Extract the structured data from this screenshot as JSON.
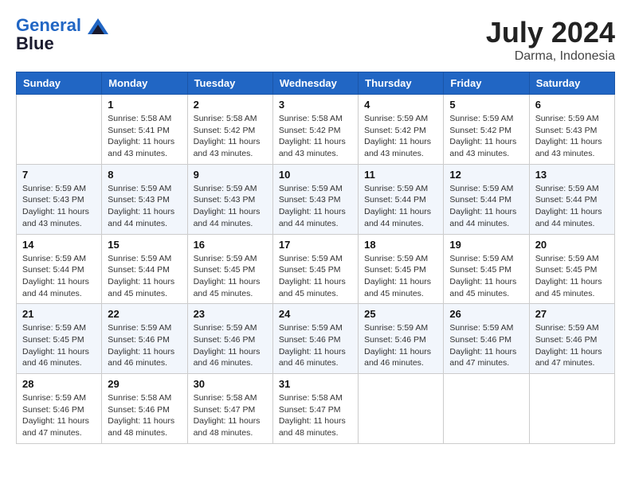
{
  "header": {
    "logo_line1": "General",
    "logo_line2": "Blue",
    "month_year": "July 2024",
    "location": "Darma, Indonesia"
  },
  "weekdays": [
    "Sunday",
    "Monday",
    "Tuesday",
    "Wednesday",
    "Thursday",
    "Friday",
    "Saturday"
  ],
  "weeks": [
    [
      {
        "day": "",
        "empty": true
      },
      {
        "day": "1",
        "sunrise": "5:58 AM",
        "sunset": "5:41 PM",
        "daylight": "11 hours and 43 minutes."
      },
      {
        "day": "2",
        "sunrise": "5:58 AM",
        "sunset": "5:42 PM",
        "daylight": "11 hours and 43 minutes."
      },
      {
        "day": "3",
        "sunrise": "5:58 AM",
        "sunset": "5:42 PM",
        "daylight": "11 hours and 43 minutes."
      },
      {
        "day": "4",
        "sunrise": "5:59 AM",
        "sunset": "5:42 PM",
        "daylight": "11 hours and 43 minutes."
      },
      {
        "day": "5",
        "sunrise": "5:59 AM",
        "sunset": "5:42 PM",
        "daylight": "11 hours and 43 minutes."
      },
      {
        "day": "6",
        "sunrise": "5:59 AM",
        "sunset": "5:43 PM",
        "daylight": "11 hours and 43 minutes."
      }
    ],
    [
      {
        "day": "7",
        "sunrise": "5:59 AM",
        "sunset": "5:43 PM",
        "daylight": "11 hours and 43 minutes."
      },
      {
        "day": "8",
        "sunrise": "5:59 AM",
        "sunset": "5:43 PM",
        "daylight": "11 hours and 44 minutes."
      },
      {
        "day": "9",
        "sunrise": "5:59 AM",
        "sunset": "5:43 PM",
        "daylight": "11 hours and 44 minutes."
      },
      {
        "day": "10",
        "sunrise": "5:59 AM",
        "sunset": "5:43 PM",
        "daylight": "11 hours and 44 minutes."
      },
      {
        "day": "11",
        "sunrise": "5:59 AM",
        "sunset": "5:44 PM",
        "daylight": "11 hours and 44 minutes."
      },
      {
        "day": "12",
        "sunrise": "5:59 AM",
        "sunset": "5:44 PM",
        "daylight": "11 hours and 44 minutes."
      },
      {
        "day": "13",
        "sunrise": "5:59 AM",
        "sunset": "5:44 PM",
        "daylight": "11 hours and 44 minutes."
      }
    ],
    [
      {
        "day": "14",
        "sunrise": "5:59 AM",
        "sunset": "5:44 PM",
        "daylight": "11 hours and 44 minutes."
      },
      {
        "day": "15",
        "sunrise": "5:59 AM",
        "sunset": "5:44 PM",
        "daylight": "11 hours and 45 minutes."
      },
      {
        "day": "16",
        "sunrise": "5:59 AM",
        "sunset": "5:45 PM",
        "daylight": "11 hours and 45 minutes."
      },
      {
        "day": "17",
        "sunrise": "5:59 AM",
        "sunset": "5:45 PM",
        "daylight": "11 hours and 45 minutes."
      },
      {
        "day": "18",
        "sunrise": "5:59 AM",
        "sunset": "5:45 PM",
        "daylight": "11 hours and 45 minutes."
      },
      {
        "day": "19",
        "sunrise": "5:59 AM",
        "sunset": "5:45 PM",
        "daylight": "11 hours and 45 minutes."
      },
      {
        "day": "20",
        "sunrise": "5:59 AM",
        "sunset": "5:45 PM",
        "daylight": "11 hours and 45 minutes."
      }
    ],
    [
      {
        "day": "21",
        "sunrise": "5:59 AM",
        "sunset": "5:45 PM",
        "daylight": "11 hours and 46 minutes."
      },
      {
        "day": "22",
        "sunrise": "5:59 AM",
        "sunset": "5:46 PM",
        "daylight": "11 hours and 46 minutes."
      },
      {
        "day": "23",
        "sunrise": "5:59 AM",
        "sunset": "5:46 PM",
        "daylight": "11 hours and 46 minutes."
      },
      {
        "day": "24",
        "sunrise": "5:59 AM",
        "sunset": "5:46 PM",
        "daylight": "11 hours and 46 minutes."
      },
      {
        "day": "25",
        "sunrise": "5:59 AM",
        "sunset": "5:46 PM",
        "daylight": "11 hours and 46 minutes."
      },
      {
        "day": "26",
        "sunrise": "5:59 AM",
        "sunset": "5:46 PM",
        "daylight": "11 hours and 47 minutes."
      },
      {
        "day": "27",
        "sunrise": "5:59 AM",
        "sunset": "5:46 PM",
        "daylight": "11 hours and 47 minutes."
      }
    ],
    [
      {
        "day": "28",
        "sunrise": "5:59 AM",
        "sunset": "5:46 PM",
        "daylight": "11 hours and 47 minutes."
      },
      {
        "day": "29",
        "sunrise": "5:58 AM",
        "sunset": "5:46 PM",
        "daylight": "11 hours and 48 minutes."
      },
      {
        "day": "30",
        "sunrise": "5:58 AM",
        "sunset": "5:47 PM",
        "daylight": "11 hours and 48 minutes."
      },
      {
        "day": "31",
        "sunrise": "5:58 AM",
        "sunset": "5:47 PM",
        "daylight": "11 hours and 48 minutes."
      },
      {
        "day": "",
        "empty": true
      },
      {
        "day": "",
        "empty": true
      },
      {
        "day": "",
        "empty": true
      }
    ]
  ]
}
